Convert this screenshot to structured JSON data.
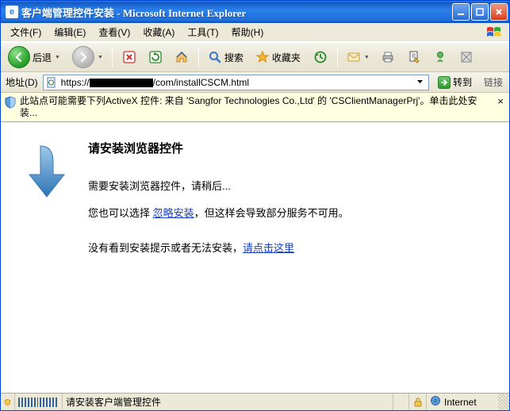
{
  "window": {
    "title": "客户端管理控件安装 - Microsoft Internet Explorer"
  },
  "menus": {
    "file": "文件(F)",
    "edit": "编辑(E)",
    "view": "查看(V)",
    "favorites": "收藏(A)",
    "tools": "工具(T)",
    "help": "帮助(H)"
  },
  "toolbar": {
    "back": "后退",
    "search": "搜索",
    "favorites": "收藏夹"
  },
  "address": {
    "label": "地址(D)",
    "prefix": "https://",
    "suffix": "com/installCSCM.html",
    "go": "转到",
    "links": "链接"
  },
  "infobar": {
    "msg": "此站点可能需要下列ActiveX 控件: 来自 'Sangfor Technologies Co.,Ltd' 的 'CSClientManagerPrj'。单击此处安装..."
  },
  "page": {
    "heading": "请安装浏览器控件",
    "p1": "需要安装浏览器控件，请稍后...",
    "p2a": "您也可以选择 ",
    "p2link": "忽略安装",
    "p2b": "，但这样会导致部分服务不可用。",
    "p3a": "没有看到安装提示或者无法安装，",
    "p3link": "请点击这里"
  },
  "status": {
    "msg": "请安装客户端管理控件",
    "zone": "Internet"
  }
}
